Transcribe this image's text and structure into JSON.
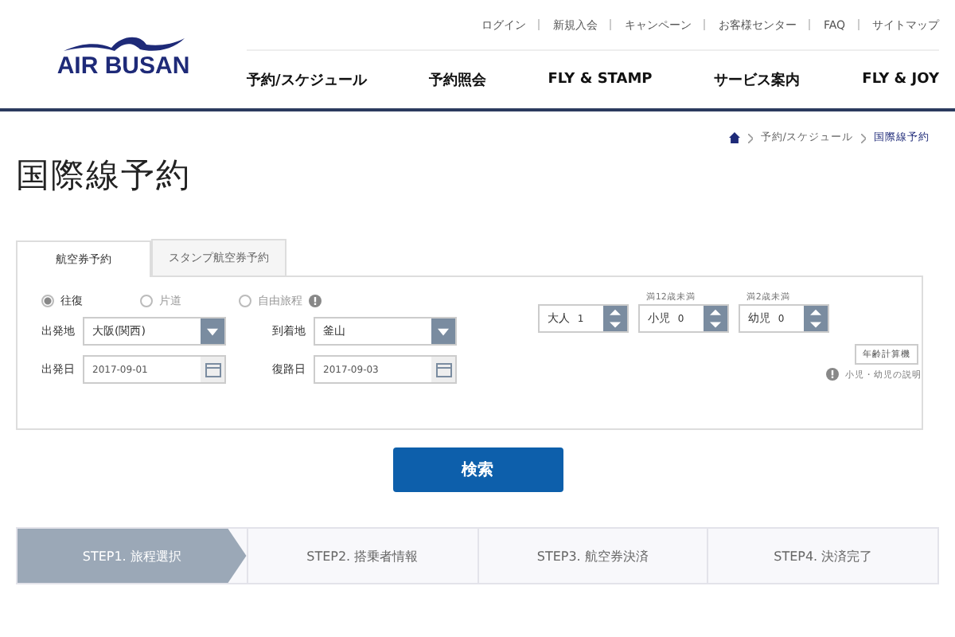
{
  "logo": {
    "text": "AIR BUSAN"
  },
  "top_links": [
    "ログイン",
    "新規入会",
    "キャンペーン",
    "お客様センター",
    "FAQ",
    "サイトマップ"
  ],
  "nav": [
    "予約/スケジュール",
    "予約照会",
    "FLY & STAMP",
    "サービス案内",
    "FLY & JOY"
  ],
  "breadcrumb": [
    "予約/スケジュール",
    "国際線予約"
  ],
  "page_title": "国際線予約",
  "tabs": [
    {
      "label": "航空券予約",
      "selected": true
    },
    {
      "label": "スタンプ航空券予約",
      "selected": false
    }
  ],
  "trip_types": [
    {
      "label": "往復",
      "selected": true,
      "info": false
    },
    {
      "label": "片道",
      "selected": false,
      "info": false
    },
    {
      "label": "自由旅程",
      "selected": false,
      "info": true
    }
  ],
  "fields": [
    {
      "label": "出発地",
      "value": "大阪(関西)",
      "kind": "select"
    },
    {
      "label": "到着地",
      "value": "釜山",
      "kind": "select"
    },
    {
      "label": "出発日",
      "value": "2017-09-01",
      "kind": "date"
    },
    {
      "label": "復路日",
      "value": "2017-09-03",
      "kind": "date"
    }
  ],
  "passengers": [
    {
      "label": "大人",
      "count": "1"
    },
    {
      "hint": "満12歳未満",
      "label": "小児",
      "count": "0"
    },
    {
      "hint": "満2歳未満",
      "label": "幼児",
      "count": "0"
    }
  ],
  "age_calc_button": "年齢計算機",
  "child_info_link": "小児・幼児の説明",
  "search_button": "検索",
  "steps": [
    {
      "label": "STEP1. 旅程選択",
      "selected": true
    },
    {
      "label": "STEP2. 搭乗者情報",
      "selected": false
    },
    {
      "label": "STEP3. 航空券決済",
      "selected": false
    },
    {
      "label": "STEP4. 決済完了",
      "selected": false
    }
  ]
}
